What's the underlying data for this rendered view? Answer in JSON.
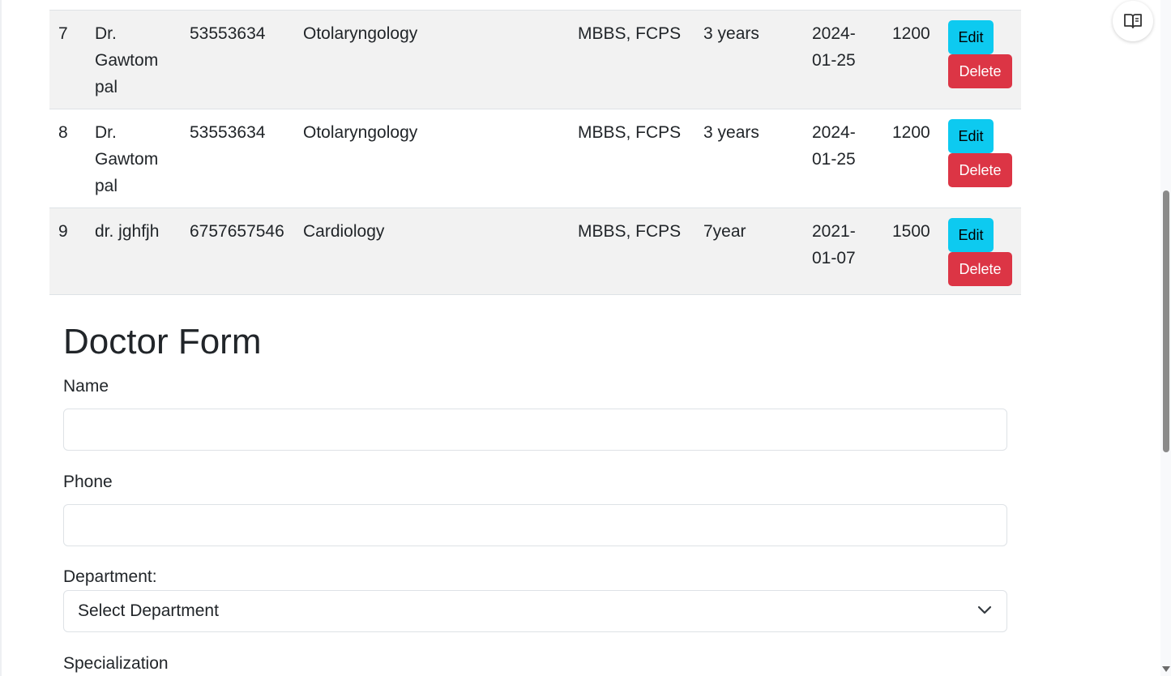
{
  "table": {
    "rows": [
      {
        "id": "7",
        "name": "Dr. Gawtom pal",
        "phone": "53553634",
        "specialization": "Otolaryngology",
        "qualification": "MBBS, FCPS",
        "experience": "3 years",
        "date": "2024-01-25",
        "fee": "1200",
        "edit_label": "Edit",
        "delete_label": "Delete"
      },
      {
        "id": "8",
        "name": "Dr. Gawtom pal",
        "phone": "53553634",
        "specialization": "Otolaryngology",
        "qualification": "MBBS, FCPS",
        "experience": "3 years",
        "date": "2024-01-25",
        "fee": "1200",
        "edit_label": "Edit",
        "delete_label": "Delete"
      },
      {
        "id": "9",
        "name": "dr. jghfjh",
        "phone": "6757657546",
        "specialization": "Cardiology",
        "qualification": "MBBS, FCPS",
        "experience": "7year",
        "date": "2021-01-07",
        "fee": "1500",
        "edit_label": "Edit",
        "delete_label": "Delete"
      }
    ]
  },
  "form": {
    "title": "Doctor Form",
    "name_label": "Name",
    "name_value": "",
    "phone_label": "Phone",
    "phone_value": "",
    "department_label": "Department:",
    "department_selected": "Select Department",
    "specialization_label": "Specialization"
  },
  "colors": {
    "edit_button": "#0dcaf0",
    "delete_button": "#dc3545",
    "striped_row": "#f2f2f2"
  },
  "icons": {
    "reader_mode": "book-open-icon",
    "select_chevron": "chevron-down-icon"
  }
}
